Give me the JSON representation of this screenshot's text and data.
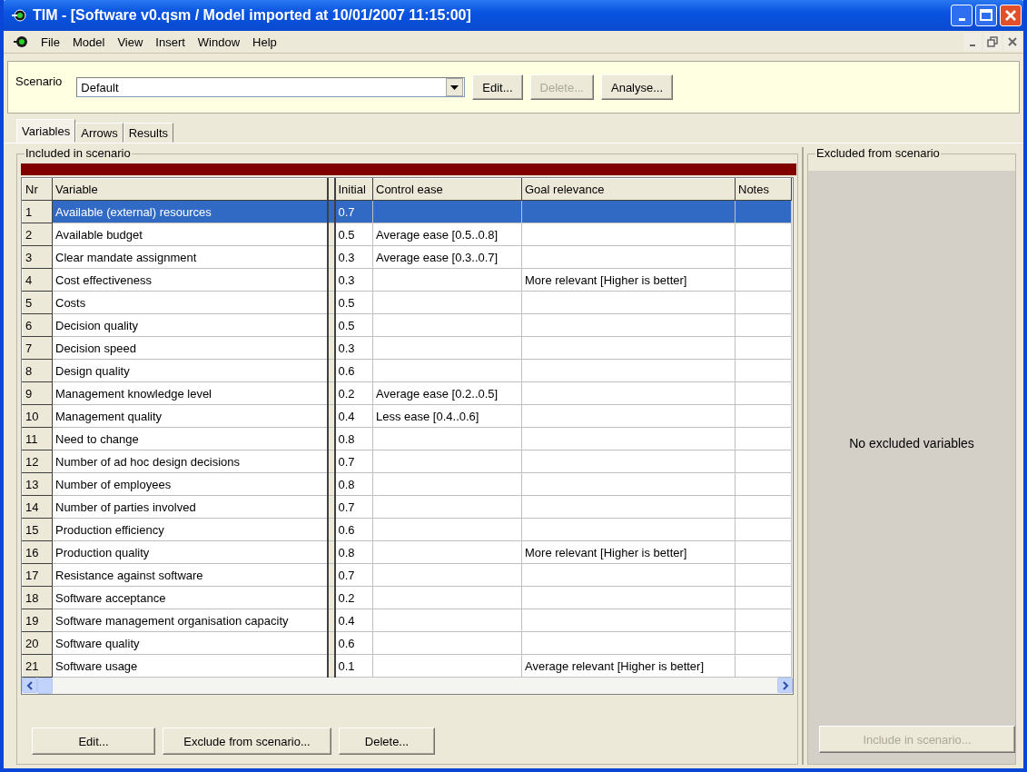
{
  "window": {
    "title": "TIM - [Software v0.qsm / Model imported at 10/01/2007 11:15:00]"
  },
  "menu": [
    "File",
    "Model",
    "View",
    "Insert",
    "Window",
    "Help"
  ],
  "scenario": {
    "label": "Scenario",
    "value": "Default",
    "buttons": [
      {
        "label": "Edit...",
        "disabled": false
      },
      {
        "label": "Delete...",
        "disabled": true
      },
      {
        "label": "Analyse...",
        "disabled": false
      }
    ]
  },
  "tabs": [
    {
      "label": "Variables",
      "selected": true
    },
    {
      "label": "Arrows",
      "selected": false
    },
    {
      "label": "Results",
      "selected": false
    }
  ],
  "included": {
    "title": "Included in scenario",
    "columns": [
      "Nr",
      "Variable",
      "Initial",
      "Control ease",
      "Goal relevance",
      "Notes"
    ],
    "rows": [
      {
        "nr": "1",
        "variable": "Available (external) resources",
        "initial": "0.7",
        "control_ease": "",
        "goal_relevance": "",
        "selected": true
      },
      {
        "nr": "2",
        "variable": "Available budget",
        "initial": "0.5",
        "control_ease": "Average ease [0.5..0.8]",
        "goal_relevance": "",
        "selected": false
      },
      {
        "nr": "3",
        "variable": "Clear mandate assignment",
        "initial": "0.3",
        "control_ease": "Average ease [0.3..0.7]",
        "goal_relevance": "",
        "selected": false
      },
      {
        "nr": "4",
        "variable": "Cost effectiveness",
        "initial": "0.3",
        "control_ease": "",
        "goal_relevance": "More relevant [Higher is better]",
        "selected": false
      },
      {
        "nr": "5",
        "variable": "Costs",
        "initial": "0.5",
        "control_ease": "",
        "goal_relevance": "",
        "selected": false
      },
      {
        "nr": "6",
        "variable": "Decision quality",
        "initial": "0.5",
        "control_ease": "",
        "goal_relevance": "",
        "selected": false
      },
      {
        "nr": "7",
        "variable": "Decision speed",
        "initial": "0.3",
        "control_ease": "",
        "goal_relevance": "",
        "selected": false
      },
      {
        "nr": "8",
        "variable": "Design quality",
        "initial": "0.6",
        "control_ease": "",
        "goal_relevance": "",
        "selected": false
      },
      {
        "nr": "9",
        "variable": "Management knowledge level",
        "initial": "0.2",
        "control_ease": "Average ease [0.2..0.5]",
        "goal_relevance": "",
        "selected": false
      },
      {
        "nr": "10",
        "variable": "Management quality",
        "initial": "0.4",
        "control_ease": "Less ease [0.4..0.6]",
        "goal_relevance": "",
        "selected": false
      },
      {
        "nr": "11",
        "variable": "Need to change",
        "initial": "0.8",
        "control_ease": "",
        "goal_relevance": "",
        "selected": false
      },
      {
        "nr": "12",
        "variable": "Number of ad hoc design decisions",
        "initial": "0.7",
        "control_ease": "",
        "goal_relevance": "",
        "selected": false
      },
      {
        "nr": "13",
        "variable": "Number of employees",
        "initial": "0.8",
        "control_ease": "",
        "goal_relevance": "",
        "selected": false
      },
      {
        "nr": "14",
        "variable": "Number of parties involved",
        "initial": "0.7",
        "control_ease": "",
        "goal_relevance": "",
        "selected": false
      },
      {
        "nr": "15",
        "variable": "Production efficiency",
        "initial": "0.6",
        "control_ease": "",
        "goal_relevance": "",
        "selected": false
      },
      {
        "nr": "16",
        "variable": "Production quality",
        "initial": "0.8",
        "control_ease": "",
        "goal_relevance": "More relevant [Higher is better]",
        "selected": false
      },
      {
        "nr": "17",
        "variable": "Resistance against software",
        "initial": "0.7",
        "control_ease": "",
        "goal_relevance": "",
        "selected": false
      },
      {
        "nr": "18",
        "variable": "Software acceptance",
        "initial": "0.2",
        "control_ease": "",
        "goal_relevance": "",
        "selected": false
      },
      {
        "nr": "19",
        "variable": "Software management organisation capacity",
        "initial": "0.4",
        "control_ease": "",
        "goal_relevance": "",
        "selected": false
      },
      {
        "nr": "20",
        "variable": "Software quality",
        "initial": "0.6",
        "control_ease": "",
        "goal_relevance": "",
        "selected": false
      },
      {
        "nr": "21",
        "variable": "Software usage",
        "initial": "0.1",
        "control_ease": "",
        "goal_relevance": "Average relevant [Higher is better]",
        "selected": false
      }
    ],
    "buttons": [
      {
        "label": "Edit...",
        "disabled": false
      },
      {
        "label": "Exclude from scenario...",
        "disabled": false
      },
      {
        "label": "Delete...",
        "disabled": false
      }
    ]
  },
  "excluded": {
    "title": "Excluded from scenario",
    "empty_text": "No excluded variables",
    "button": {
      "label": "Include in scenario...",
      "disabled": true
    }
  }
}
